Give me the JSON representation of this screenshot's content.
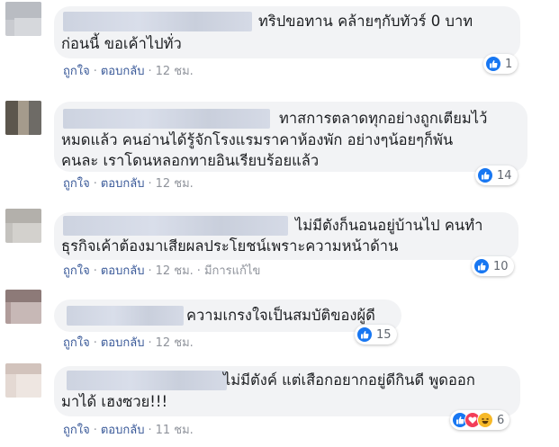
{
  "action_labels": {
    "like": "ถูกใจ",
    "reply": "ตอบกลับ",
    "edited": "มีการแก้ไข"
  },
  "colors": {
    "link": "#385898",
    "meta": "#90949c",
    "bubble": "#f2f3f5",
    "like_blue": "#1877f2",
    "love_red": "#f33e58",
    "haha_yellow": "#f7b928"
  },
  "comments": [
    {
      "lines": [
        "ทริปขอทาน คล้ายๆกับทัวร์ 0 บาท",
        "ก่อนนี้ ขอเค้าไปทั่ว"
      ],
      "time": "12 ชม.",
      "reactions": [
        "like-icon"
      ],
      "reaction_count": "1"
    },
    {
      "lines": [
        "ทาสการตลาดทุกอย่างถูกเตียมไว้",
        "หมดแล้ว คนอ่านได้รู้จักโรงแรมราคาห้องพัก อย่างๆน้อยๆก็พัน",
        "คนละ เราโดนหลอกทายอินเรียบร้อยแล้ว"
      ],
      "time": "12 ชม.",
      "reactions": [
        "like-icon"
      ],
      "reaction_count": "14"
    },
    {
      "lines": [
        "ไม่มีตังก็นอนอยู่บ้านไป คนทำ",
        "ธุรกิจเค้าต้องมาเสียผลประโยชน์เพราะความหน้าด้าน"
      ],
      "time": "12 ชม.",
      "edited": true,
      "reactions": [
        "like-icon"
      ],
      "reaction_count": "10"
    },
    {
      "lines": [
        "ความเกรงใจเป็นสมบัติของผู้ดี"
      ],
      "time": "12 ชม.",
      "reactions": [
        "like-icon"
      ],
      "reaction_count": "15"
    },
    {
      "lines": [
        "ไม่มีตังค์ แต่เสือกอยากอยู่ดีกินดี พูดออก",
        "มาได้ เฮงซวย!!!"
      ],
      "time": "11 ชม.",
      "reactions": [
        "like-icon",
        "love-icon",
        "haha-icon"
      ],
      "reaction_count": "6"
    }
  ]
}
